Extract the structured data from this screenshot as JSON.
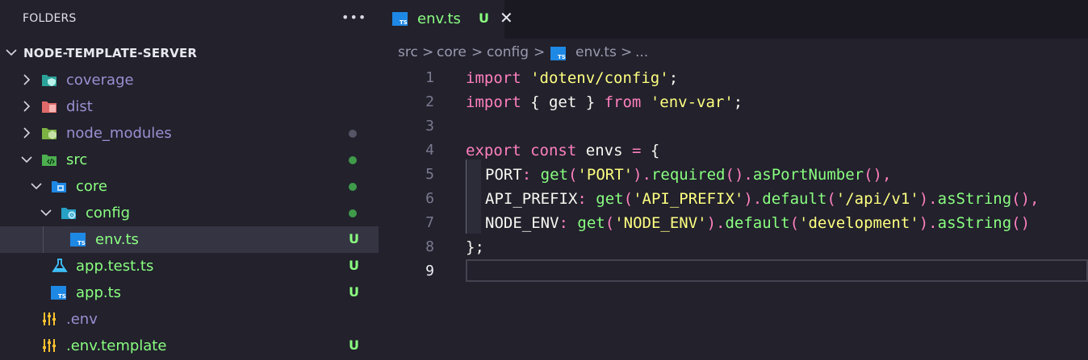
{
  "sidebar": {
    "title": "FOLDERS",
    "more_label": "•••",
    "root": "NODE-TEMPLATE-SERVER",
    "items": [
      {
        "label": "coverage",
        "status": "dot-gray"
      },
      {
        "label": "dist",
        "status": ""
      },
      {
        "label": "node_modules",
        "status": "dot-gray"
      },
      {
        "label": "src",
        "status": "dot-green"
      },
      {
        "label": "core",
        "status": "dot-green"
      },
      {
        "label": "config",
        "status": "dot-green"
      },
      {
        "label": "env.ts",
        "badge": "U"
      },
      {
        "label": "app.test.ts",
        "badge": "U"
      },
      {
        "label": "app.ts",
        "badge": "U"
      },
      {
        "label": ".env",
        "badge": ""
      },
      {
        "label": ".env.template",
        "badge": "U"
      }
    ]
  },
  "tab": {
    "name": "env.ts",
    "badge": "U",
    "close": "✕",
    "icon_text": "TS"
  },
  "breadcrumb": {
    "parts": [
      "src",
      "core",
      "config",
      "env.ts",
      "..."
    ],
    "sep": ">"
  },
  "editor": {
    "line_numbers": [
      "1",
      "2",
      "3",
      "4",
      "5",
      "6",
      "7",
      "8",
      "9"
    ],
    "lines": {
      "l1_kw": "import",
      "l1_str": "'dotenv/config'",
      "l1_end": ";",
      "l2_kw": "import",
      "l2_mid": " { get } ",
      "l2_from": "from",
      "l2_str": "'env-var'",
      "l2_end": ";",
      "l4_export": "export",
      "l4_const": "const",
      "l4_name": "envs",
      "l4_eq": "=",
      "l4_brace": "{",
      "l5_key": "PORT",
      "l5_colon": ":",
      "l5_get": "get",
      "l5_arg": "'PORT'",
      "l5_req": "required",
      "l5_asp": "asPortNumber",
      "l6_key": "API_PREFIX",
      "l6_arg": "'API_PREFIX'",
      "l6_def": "default",
      "l6_defarg": "'/api/v1'",
      "l6_as": "asString",
      "l7_key": "NODE_ENV",
      "l7_arg": "'NODE_ENV'",
      "l7_defarg": "'development'",
      "l8": "};"
    }
  },
  "colors": {
    "green": "#8aff80",
    "purple_label": "#9b8fd1",
    "pink": "#ff80bf",
    "yellow": "#ffff80",
    "gray_dot": "#555566",
    "green_dot": "#3f9a4a"
  }
}
